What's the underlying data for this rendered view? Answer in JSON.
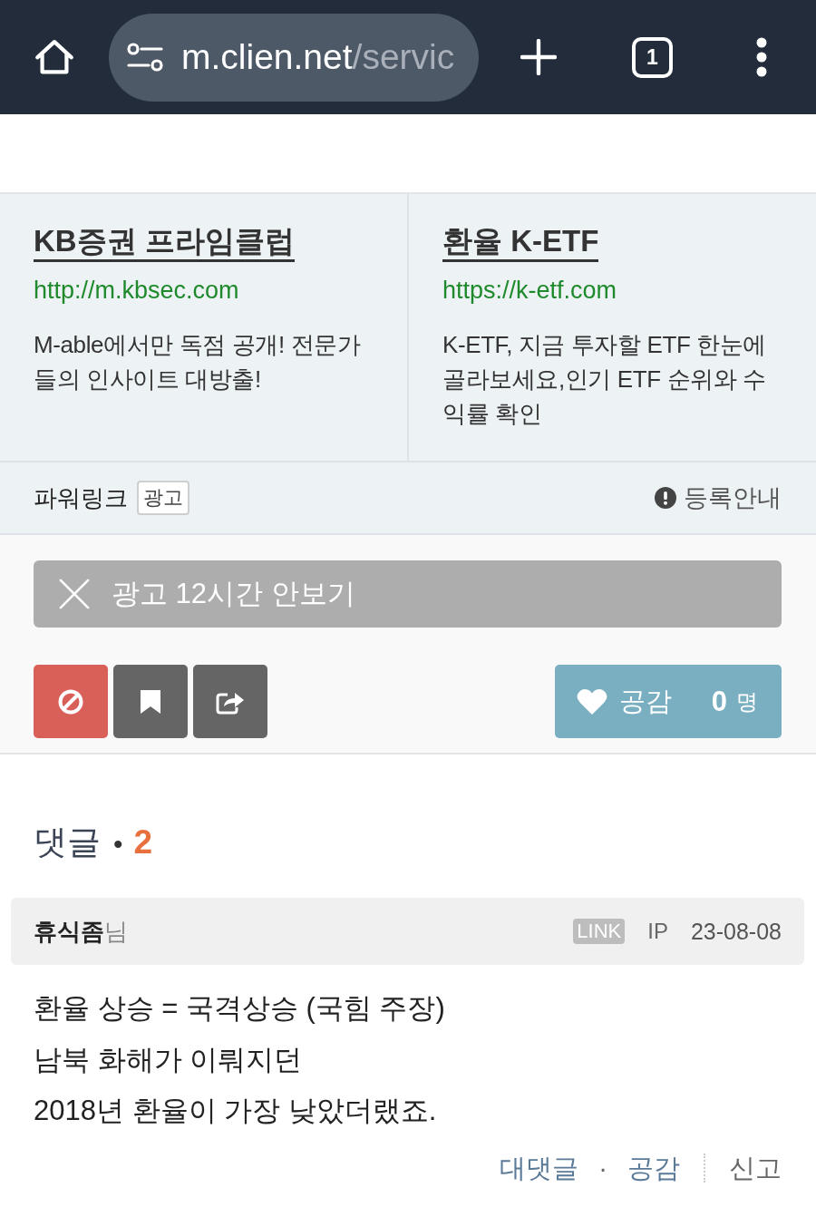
{
  "browser": {
    "url_host": "m.clien.net",
    "url_path": "/servic",
    "tab_count": "1"
  },
  "ads": [
    {
      "title": "KB증권 프라임클럽",
      "url": "http://m.kbsec.com",
      "description": "M-able에서만 독점 공개! 전문가들의 인사이트 대방출!"
    },
    {
      "title": "환율 K-ETF",
      "url": "https://k-etf.com",
      "description": "K-ETF, 지금 투자할 ETF 한눈에 골라보세요,인기 ETF 순위와 수익률 확인"
    }
  ],
  "powerlink": {
    "label": "파워링크",
    "badge": "광고",
    "info": "등록안내"
  },
  "hide_ad_button": {
    "label": "광고 12시간 안보기"
  },
  "like_button": {
    "label": "공감",
    "count": "0",
    "unit": "명"
  },
  "comments": {
    "title": "댓글",
    "separator": "•",
    "count": "2",
    "items": [
      {
        "author": "휴식좀",
        "honorific": "님",
        "badge": "LINK",
        "ip": "IP",
        "date": "23-08-08",
        "text": "환율 상승 = 국격상승 (국힘 주장)\n남북 화해가 이뤄지던\n2018년 환율이 가장 낮았더랬죠.",
        "actions": [
          "대댓글",
          "공감",
          "신고"
        ],
        "action_separator": "·"
      }
    ]
  }
}
